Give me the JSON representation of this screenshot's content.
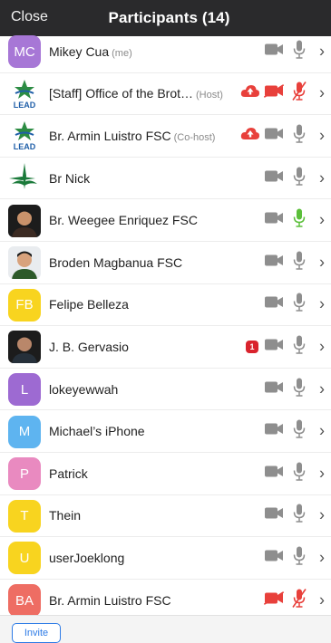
{
  "header": {
    "close_label": "Close",
    "title": "Participants (14)"
  },
  "participants": [
    {
      "name": "Mikey Cua",
      "tag": "(me)",
      "initials": "MC",
      "avatar_color": "#a777d6",
      "cam": "gray",
      "mic": "gray",
      "cloud": false,
      "badge": ""
    },
    {
      "name": "[Staff] Office of the Brot…",
      "tag": "(Host)",
      "initials": "",
      "avatar_color": "",
      "avatar_icon": "lead-logo-icon",
      "cam": "red",
      "mic": "red",
      "cloud": true,
      "badge": ""
    },
    {
      "name": "Br. Armin Luistro FSC",
      "tag": "(Co-host)",
      "initials": "",
      "avatar_color": "",
      "avatar_icon": "lead-logo-icon",
      "cam": "gray",
      "mic": "gray",
      "cloud": true,
      "badge": ""
    },
    {
      "name": "Br Nick",
      "tag": "",
      "initials": "",
      "avatar_color": "",
      "avatar_icon": "lasallian-star-logo-icon",
      "cam": "gray",
      "mic": "gray",
      "cloud": false,
      "badge": ""
    },
    {
      "name": "Br. Weegee Enriquez FSC",
      "tag": "",
      "initials": "",
      "avatar_color": "",
      "avatar_icon": "profile-photo",
      "cam": "gray",
      "mic": "green",
      "cloud": false,
      "badge": ""
    },
    {
      "name": "Broden Magbanua FSC",
      "tag": "",
      "initials": "",
      "avatar_color": "",
      "avatar_icon": "profile-photo",
      "cam": "gray",
      "mic": "gray",
      "cloud": false,
      "badge": ""
    },
    {
      "name": "Felipe Belleza",
      "tag": "",
      "initials": "FB",
      "avatar_color": "#f8d41f",
      "cam": "gray",
      "mic": "gray",
      "cloud": false,
      "badge": ""
    },
    {
      "name": "J. B. Gervasio",
      "tag": "",
      "initials": "",
      "avatar_color": "",
      "avatar_icon": "profile-photo",
      "cam": "gray",
      "mic": "gray",
      "cloud": false,
      "badge": "1"
    },
    {
      "name": "lokeyewwah",
      "tag": "",
      "initials": "L",
      "avatar_color": "#9d6ad2",
      "cam": "gray",
      "mic": "gray",
      "cloud": false,
      "badge": ""
    },
    {
      "name": "Michael’s iPhone",
      "tag": "",
      "initials": "M",
      "avatar_color": "#5eb4f0",
      "cam": "gray",
      "mic": "gray",
      "cloud": false,
      "badge": ""
    },
    {
      "name": "Patrick",
      "tag": "",
      "initials": "P",
      "avatar_color": "#e98ac0",
      "cam": "gray",
      "mic": "gray",
      "cloud": false,
      "badge": ""
    },
    {
      "name": "Thein",
      "tag": "",
      "initials": "T",
      "avatar_color": "#f8d41f",
      "cam": "gray",
      "mic": "gray",
      "cloud": false,
      "badge": ""
    },
    {
      "name": "userJoeklong",
      "tag": "",
      "initials": "U",
      "avatar_color": "#f8d41f",
      "cam": "gray",
      "mic": "gray",
      "cloud": false,
      "badge": ""
    },
    {
      "name": "Br. Armin Luistro FSC",
      "tag": "",
      "initials": "BA",
      "avatar_color": "#ee6d63",
      "cam": "red",
      "mic": "red",
      "cloud": false,
      "badge": ""
    }
  ],
  "footer": {
    "invite_label": "Invite"
  },
  "colors": {
    "header_bg": "#2a2a2c",
    "accent_blue": "#2d7be6",
    "icon_gray": "#8e8e8e",
    "muted_red": "#e8403b",
    "talking_green": "#5bbf3a"
  }
}
